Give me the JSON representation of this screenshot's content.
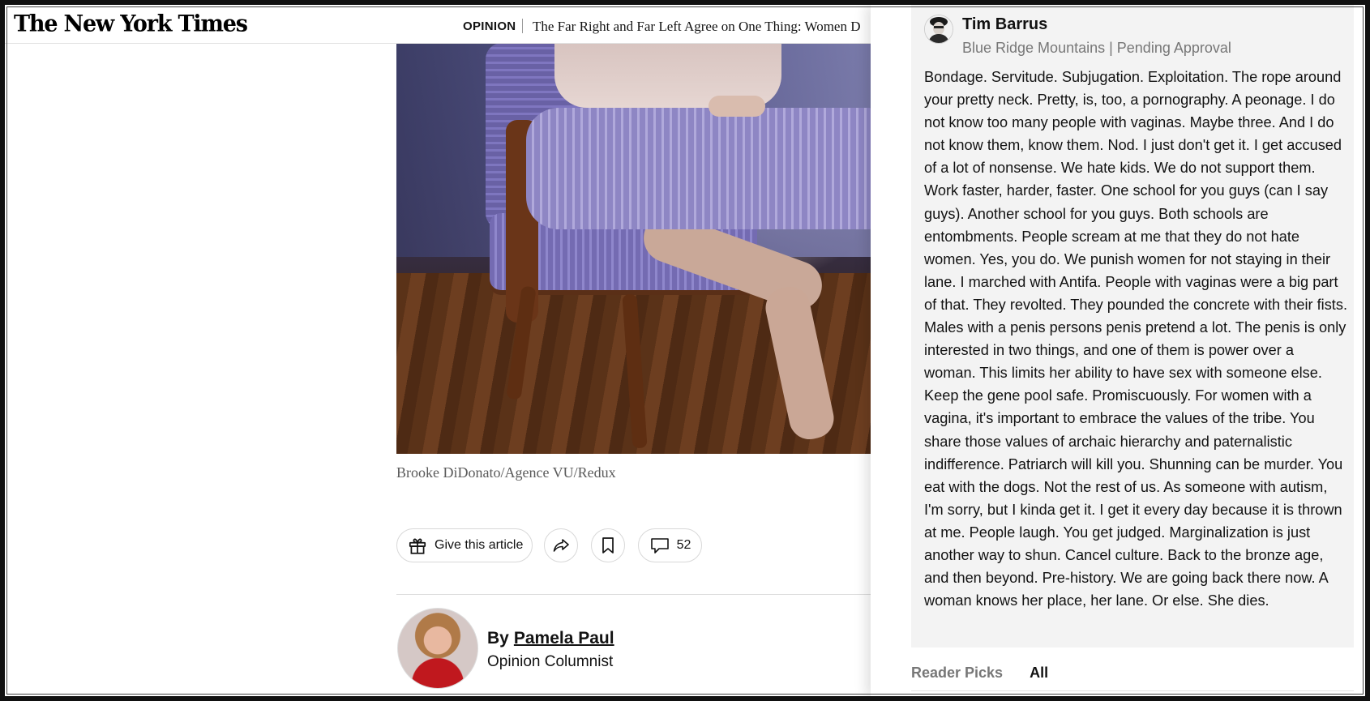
{
  "header": {
    "logo": "The New York Times",
    "section": "OPINION",
    "headline": "The Far Right and Far Left Agree on One Thing: Women D"
  },
  "article": {
    "photo_credit": "Brooke DiDonato/Agence VU/Redux",
    "actions": {
      "gift_label": "Give this article",
      "comment_count": "52"
    },
    "byline": {
      "by": "By",
      "author": "Pamela Paul",
      "role": "Opinion Columnist"
    }
  },
  "comments_panel": {
    "comment": {
      "author": "Tim Barrus",
      "meta": "Blue Ridge Mountains | Pending Approval",
      "body": "Bondage. Servitude. Subjugation. Exploitation. The rope around your pretty neck. Pretty, is, too, a pornography. A peonage. I do not know too many people with vaginas. Maybe three. And I do not know them, know them. Nod. I just don't get it. I get accused of a lot of nonsense. We hate kids. We do not support them. Work faster, harder, faster. One school for you guys (can I say guys). Another school for you guys. Both schools are entombments. People scream at me that they do not hate women. Yes, you do. We punish women for not staying in their lane. I marched with Antifa. People with vaginas were a big part of that. They revolted. They pounded the concrete with their fists. Males with a penis persons penis pretend a lot. The penis is only interested in two things, and one of them is power over a woman. This limits her ability to have sex with someone else. Keep the gene pool safe. Promiscuously. For women with a vagina, it's important to embrace the values of the tribe. You share those values of archaic hierarchy and paternalistic indifference. Patriarch will kill you. Shunning can be murder. You eat with the dogs. Not the rest of us. As someone with autism, I'm sorry, but I kinda get it. I get it every day because it is thrown at me. People laugh. You get judged. Marginalization is just another way to shun. Cancel culture. Back to the bronze age, and then beyond. Pre-history. We are going back there now. A woman knows her place, her lane. Or else. She dies."
    },
    "tabs": [
      "Reader Picks",
      "All"
    ]
  },
  "icons": {
    "gift": "gift-icon",
    "share": "share-icon",
    "bookmark": "bookmark-icon",
    "comment": "comment-bubble-icon"
  }
}
